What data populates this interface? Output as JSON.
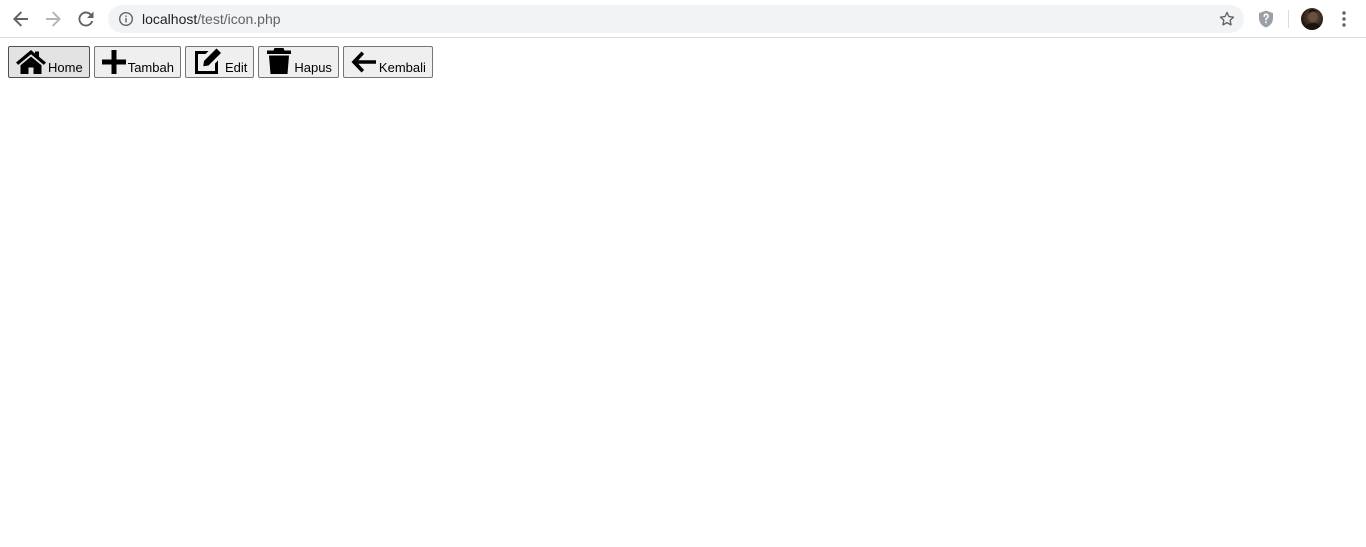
{
  "browser": {
    "url_host": "localhost",
    "url_path": "/test/icon.php",
    "back_icon": "arrow-left-icon",
    "forward_icon": "arrow-right-icon",
    "reload_icon": "reload-icon",
    "info_icon": "info-icon",
    "star_icon": "star-icon",
    "extension_icon": "shield-icon",
    "menu_icon": "kebab-menu-icon"
  },
  "buttons": [
    {
      "label": "Home",
      "icon": "home-icon"
    },
    {
      "label": "Tambah",
      "icon": "plus-icon"
    },
    {
      "label": "Edit",
      "icon": "edit-icon"
    },
    {
      "label": "Hapus",
      "icon": "trash-icon"
    },
    {
      "label": "Kembali",
      "icon": "arrow-left-icon"
    }
  ],
  "colors": {
    "button_bg": "#efefef",
    "button_border": "#767676",
    "omnibox_bg": "#f1f3f4",
    "icon": "#000000"
  }
}
